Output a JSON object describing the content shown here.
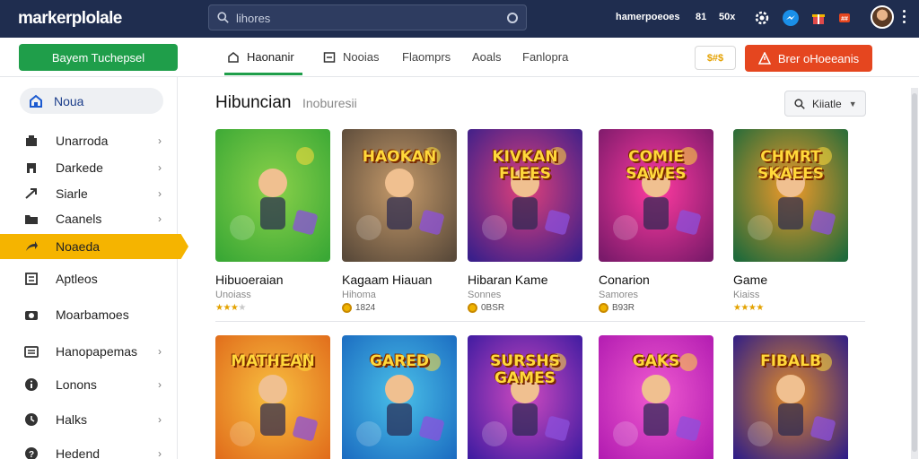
{
  "header": {
    "logo": "markerplolale",
    "search_placeholder": "lihores",
    "links": [
      "hamerpoeoes",
      "81",
      "50x"
    ],
    "badge_icon_text": "##"
  },
  "toolbar": {
    "green_button": "Bayem  Tuchepsel",
    "tabs": [
      "Haonanir",
      "Nooias",
      "Flaomprs",
      "Aoals",
      "Fanlopra"
    ],
    "active_tab": 0,
    "yellow_button": "$#$",
    "red_button": "Brer oHoeeanis"
  },
  "sidebar": {
    "home": "Noua",
    "items": [
      {
        "label": "Unarroda",
        "icon": "store-icon",
        "chevron": true
      },
      {
        "label": "Darkede",
        "icon": "building-icon",
        "chevron": true
      },
      {
        "label": "Siarle",
        "icon": "arrow-icon",
        "chevron": true
      },
      {
        "label": "Caanels",
        "icon": "folder-icon",
        "chevron": true
      },
      {
        "label": "Noaeda",
        "icon": "send-icon",
        "chevron": false,
        "highlight": true
      },
      {
        "label": "Aptleos",
        "icon": "list-icon",
        "chevron": false
      },
      {
        "label": "Moarbamoes",
        "icon": "camera-icon",
        "chevron": false
      },
      {
        "label": "Hanopapemas",
        "icon": "card-icon",
        "chevron": true
      },
      {
        "label": "Lonons",
        "icon": "info-icon",
        "chevron": true
      },
      {
        "label": "Halks",
        "icon": "clock-icon",
        "chevron": true
      },
      {
        "label": "Hedend",
        "icon": "help-icon",
        "chevron": true
      }
    ]
  },
  "main": {
    "title": "Hibuncian",
    "subtitle": "Inoburesii",
    "sort_label": "Kiiatle",
    "games_row1": [
      {
        "title": "Hibuoeraian",
        "category": "Unoiass",
        "rating": 3,
        "thumb_text": "",
        "colors": [
          "#3aa835",
          "#8bd14a"
        ]
      },
      {
        "title": "Kagaam Hiauan",
        "category": "Hihoma",
        "meta": "1824",
        "thumb_text": "HAOKAN",
        "colors": [
          "#5a4a3a",
          "#c59a6a"
        ]
      },
      {
        "title": "Hibaran Kame",
        "category": "Sonnes",
        "meta": "0BSR",
        "thumb_text": "KIVKAN FLEES",
        "colors": [
          "#3a1f8a",
          "#e0407a"
        ]
      },
      {
        "title": "Conarion",
        "category": "Samores",
        "meta": "B93R",
        "thumb_text": "COMIE SAWES",
        "colors": [
          "#7a1a6a",
          "#ff3aa0"
        ]
      },
      {
        "title": "Game",
        "category": "Kiaiss",
        "rating": 4,
        "thumb_text": "CHMRT SKAEES",
        "colors": [
          "#1f6a3a",
          "#f09a2a"
        ]
      }
    ],
    "games_row2": [
      {
        "thumb_text": "MATHEAN",
        "colors": [
          "#e06a1a",
          "#f8c040"
        ]
      },
      {
        "thumb_text": "GARED",
        "colors": [
          "#1a6ac0",
          "#4ac0e8"
        ]
      },
      {
        "thumb_text": "SURSHS GAMES",
        "colors": [
          "#3a1aa0",
          "#d04ac0"
        ]
      },
      {
        "thumb_text": "GAKS",
        "colors": [
          "#b01ab0",
          "#f05ad0"
        ]
      },
      {
        "thumb_text": "FIBALB",
        "colors": [
          "#2a1a8a",
          "#e08a2a"
        ]
      }
    ]
  },
  "colors": {
    "topbar": "#1f2d4f",
    "green": "#1f9e4a",
    "red": "#e5461f",
    "highlight": "#f5b400"
  }
}
